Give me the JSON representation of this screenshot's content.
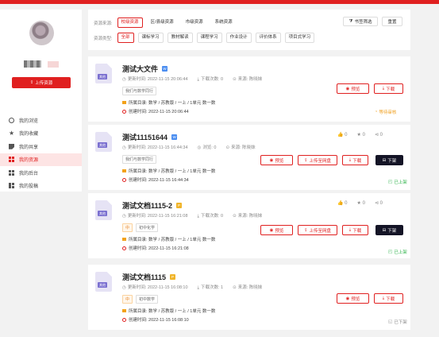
{
  "sidebar": {
    "upload_label": "上传资源",
    "items": [
      {
        "label": "我的浏览",
        "icon": "eye-icon"
      },
      {
        "label": "我的收藏",
        "icon": "star-icon"
      },
      {
        "label": "我的共享",
        "icon": "share-icon"
      },
      {
        "label": "我的资源",
        "icon": "grid-icon",
        "active": true
      },
      {
        "label": "我的后台",
        "icon": "dashboard-icon"
      },
      {
        "label": "我的投稿",
        "icon": "tile-icon"
      }
    ]
  },
  "filters": {
    "source_label": "资源来源:",
    "sources": [
      "校级资源",
      "区/县级资源",
      "市级资源",
      "系统资源"
    ],
    "type_label": "资源类型:",
    "types": [
      "全部",
      "课标学习",
      "教材解读",
      "课程学习",
      "作业设计",
      "评价体系",
      "项目式学习"
    ],
    "condition_label": "书签筛选",
    "reset_label": "重置"
  },
  "cards": [
    {
      "title": "测试大文件",
      "badge": "W",
      "file_tag": "其他",
      "update_time": "更新时间: 2022-11-15 20:06:44",
      "downloads": "下载次数: 0",
      "source": "来源: 陈晓妹",
      "tag": "我们与数学同行",
      "catalog": "所属目录: 数学 / 苏教版 / 一上 / 1单元 数一数",
      "created": "创建时间: 2022-11-15 20:06:44",
      "preview_label": "预览",
      "download_label": "下载",
      "status": "等待审核"
    },
    {
      "title": "测试11151644",
      "badge": "W",
      "file_tag": "其他",
      "update_time": "更新时间: 2022-11-15 16:44:34",
      "views": "浏览: 0",
      "source": "来源: 陈晓妹",
      "tag": "我们与数学同行",
      "catalog": "所属目录: 数学 / 苏教版 / 一上 / 1单元 数一数",
      "created": "创建时间: 2022-11-15 16:44:34",
      "likes": "0",
      "stars": "0",
      "shares": "0",
      "preview_label": "预览",
      "cloud_label": "上传至网盘",
      "download_label": "下载",
      "unlist_label": "下架",
      "status": "已上架"
    },
    {
      "title": "测试文档1115-2",
      "badge": "P",
      "file_tag": "其他",
      "update_time": "更新时间: 2022-11-15 16:21:08",
      "downloads": "下载次数: 0",
      "source": "来源: 陈晓妹",
      "level_tag": "中",
      "tag": "初中化学",
      "catalog": "所属目录: 数学 / 苏教版 / 一上 / 1单元 数一数",
      "created": "创建时间: 2022-11-15 16:21:08",
      "likes": "0",
      "stars": "0",
      "shares": "0",
      "preview_label": "预览",
      "cloud_label": "上传至网盘",
      "download_label": "下载",
      "unlist_label": "下架",
      "status": "已上架"
    },
    {
      "title": "测试文档1115",
      "badge": "P",
      "file_tag": "其他",
      "update_time": "更新时间: 2022-11-15 16:08:10",
      "downloads": "下载次数: 1",
      "source": "来源: 陈晓妹",
      "level_tag": "中",
      "tag": "初中数学",
      "catalog": "所属目录: 数学 / 苏教版 / 一上 / 1单元 数一数",
      "created": "创建时间: 2022-11-15 16:08:10",
      "preview_label": "预览",
      "download_label": "下载",
      "status": "已下架"
    }
  ],
  "colors": {
    "accent": "#e02020",
    "dark_button": "#141426",
    "pending": "#f0a020",
    "listed": "#2fb34a"
  }
}
